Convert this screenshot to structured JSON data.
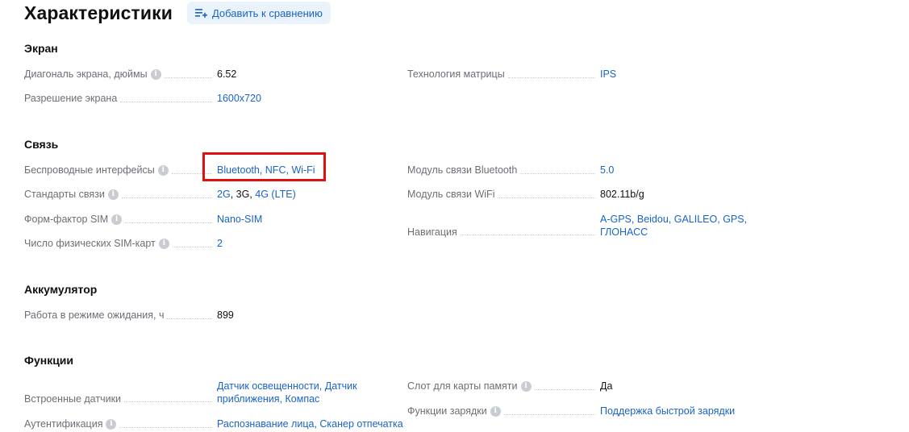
{
  "header": {
    "title": "Характеристики",
    "compare_label": "Добавить к сравнению"
  },
  "sections": {
    "screen": {
      "title": "Экран",
      "diagonal": {
        "label": "Диагональ экрана, дюймы",
        "value": "6.52"
      },
      "resolution": {
        "label": "Разрешение экрана",
        "value": "1600x720"
      },
      "matrix": {
        "label": "Технология матрицы",
        "value": "IPS"
      }
    },
    "connectivity": {
      "title": "Связь",
      "wireless": {
        "label": "Беспроводные интерфейсы",
        "v1": "Bluetooth",
        "v2": "NFC",
        "v3": "Wi-Fi"
      },
      "standards": {
        "label": "Стандарты связи",
        "v1": "2G",
        "v2": "3G",
        "v3": "4G (LTE)"
      },
      "sim_form": {
        "label": "Форм-фактор SIM",
        "value": "Nano-SIM"
      },
      "sim_count": {
        "label": "Число физических SIM-карт",
        "value": "2"
      },
      "bt_module": {
        "label": "Модуль связи Bluetooth",
        "value": "5.0"
      },
      "wifi_module": {
        "label": "Модуль связи WiFi",
        "value": "802.11b/g"
      },
      "navigation": {
        "label": "Навигация",
        "v1": "A-GPS",
        "v2": "Beidou",
        "v3": "GALILEO",
        "v4": "GPS",
        "v5": "ГЛОНАСС"
      }
    },
    "battery": {
      "title": "Аккумулятор",
      "standby": {
        "label": "Работа в режиме ожидания, ч",
        "value": "899"
      }
    },
    "functions": {
      "title": "Функции",
      "sensors": {
        "label": "Встроенные датчики",
        "v1": "Датчик освещенности",
        "v2": "Датчик приближения",
        "v3": "Компас"
      },
      "auth": {
        "label": "Аутентификация",
        "v1": "Распознавание лица",
        "v2": "Сканер отпечатка"
      },
      "card_slot": {
        "label": "Слот для карты памяти",
        "value": "Да"
      },
      "charging": {
        "label": "Функции зарядки",
        "value": "Поддержка быстрой зарядки"
      }
    }
  },
  "colors": {
    "link": "#1a63c7",
    "highlight": "#e01010",
    "compare_bg": "#eaf3fb"
  }
}
